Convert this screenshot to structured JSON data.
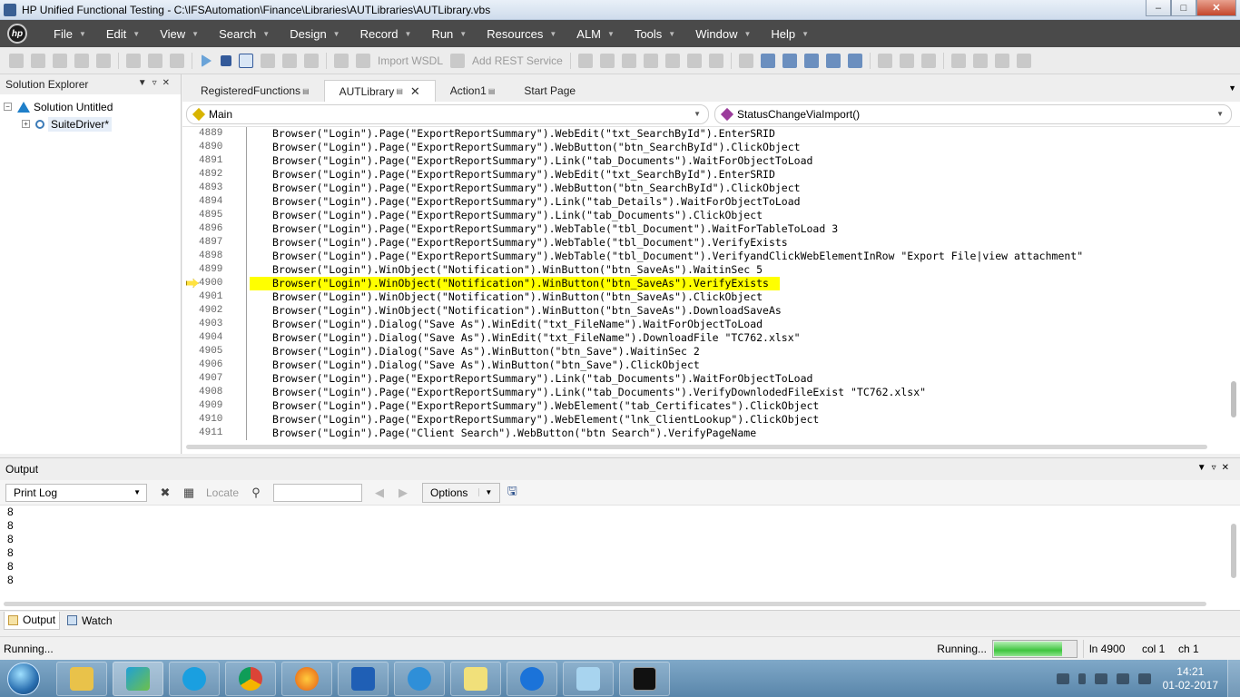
{
  "window": {
    "title": "HP Unified Functional Testing - C:\\IFSAutomation\\Finance\\Libraries\\AUTLibraries\\AUTLibrary.vbs",
    "minimize_icon": "minimize-icon",
    "maximize_icon": "maximize-icon",
    "close_icon": "close-icon"
  },
  "menubar": {
    "logo_text": "hp",
    "items": [
      {
        "label": "File"
      },
      {
        "label": "Edit"
      },
      {
        "label": "View"
      },
      {
        "label": "Search"
      },
      {
        "label": "Design"
      },
      {
        "label": "Record"
      },
      {
        "label": "Run"
      },
      {
        "label": "Resources"
      },
      {
        "label": "ALM"
      },
      {
        "label": "Tools"
      },
      {
        "label": "Window"
      },
      {
        "label": "Help"
      }
    ]
  },
  "toolbar": {
    "import_wsdl": "Import WSDL",
    "add_rest_service": "Add REST Service"
  },
  "solution_explorer": {
    "title": "Solution Explorer",
    "solution_label": "Solution Untitled",
    "suite_driver_label": "SuiteDriver*"
  },
  "editor": {
    "tabs": [
      {
        "label": "RegisteredFunctions"
      },
      {
        "label": "AUTLibrary"
      },
      {
        "label": "Action1"
      },
      {
        "label": "Start Page"
      }
    ],
    "scope_combo": "Main",
    "function_combo": "StatusChangeViaImport()",
    "current_line": 4900,
    "line_numbers": [
      "4889",
      "4890",
      "4891",
      "4892",
      "4893",
      "4894",
      "4895",
      "4896",
      "4897",
      "4898",
      "4899",
      "4900",
      "4901",
      "4902",
      "4903",
      "4904",
      "4905",
      "4906",
      "4907",
      "4908",
      "4909",
      "4910",
      "4911"
    ],
    "lines": [
      "Browser(\"Login\").Page(\"ExportReportSummary\").WebEdit(\"txt_SearchById\").EnterSRID",
      "Browser(\"Login\").Page(\"ExportReportSummary\").WebButton(\"btn_SearchById\").ClickObject",
      "Browser(\"Login\").Page(\"ExportReportSummary\").Link(\"tab_Documents\").WaitForObjectToLoad",
      "Browser(\"Login\").Page(\"ExportReportSummary\").WebEdit(\"txt_SearchById\").EnterSRID",
      "Browser(\"Login\").Page(\"ExportReportSummary\").WebButton(\"btn_SearchById\").ClickObject",
      "Browser(\"Login\").Page(\"ExportReportSummary\").Link(\"tab_Details\").WaitForObjectToLoad",
      "Browser(\"Login\").Page(\"ExportReportSummary\").Link(\"tab_Documents\").ClickObject",
      "Browser(\"Login\").Page(\"ExportReportSummary\").WebTable(\"tbl_Document\").WaitForTableToLoad 3",
      "Browser(\"Login\").Page(\"ExportReportSummary\").WebTable(\"tbl_Document\").VerifyExists",
      "Browser(\"Login\").Page(\"ExportReportSummary\").WebTable(\"tbl_Document\").VerifyandClickWebElementInRow \"Export File|view attachment\"",
      "Browser(\"Login\").WinObject(\"Notification\").WinButton(\"btn_SaveAs\").WaitinSec 5",
      "Browser(\"Login\").WinObject(\"Notification\").WinButton(\"btn_SaveAs\").VerifyExists",
      "Browser(\"Login\").WinObject(\"Notification\").WinButton(\"btn_SaveAs\").ClickObject",
      "Browser(\"Login\").WinObject(\"Notification\").WinButton(\"btn_SaveAs\").DownloadSaveAs",
      "Browser(\"Login\").Dialog(\"Save As\").WinEdit(\"txt_FileName\").WaitForObjectToLoad",
      "Browser(\"Login\").Dialog(\"Save As\").WinEdit(\"txt_FileName\").DownloadFile \"TC762.xlsx\"",
      "Browser(\"Login\").Dialog(\"Save As\").WinButton(\"btn_Save\").WaitinSec 2",
      "Browser(\"Login\").Dialog(\"Save As\").WinButton(\"btn_Save\").ClickObject",
      "Browser(\"Login\").Page(\"ExportReportSummary\").Link(\"tab_Documents\").WaitForObjectToLoad",
      "Browser(\"Login\").Page(\"ExportReportSummary\").Link(\"tab_Documents\").VerifyDownlodedFileExist \"TC762.xlsx\"",
      "Browser(\"Login\").Page(\"ExportReportSummary\").WebElement(\"tab_Certificates\").ClickObject",
      "Browser(\"Login\").Page(\"ExportReportSummary\").WebElement(\"lnk_ClientLookup\").ClickObject",
      "Browser(\"Login\").Page(\"Client Search\").WebButton(\"btn Search\").VerifyPageName"
    ]
  },
  "output": {
    "title": "Output",
    "print_log_select": "Print Log",
    "locate_label": "Locate",
    "search_value": "",
    "options_label": "Options",
    "lines": [
      "8",
      "8",
      "8",
      "8",
      "8",
      "8"
    ]
  },
  "bottom_tabs": [
    {
      "label": "Output"
    },
    {
      "label": "Watch"
    }
  ],
  "statusbar": {
    "left_text": "Running...",
    "right_text": "Running...",
    "progress_fraction": 0.82,
    "line": "ln 4900",
    "col": "col 1",
    "ch": "ch 1"
  },
  "taskbar": {
    "time": "14:21",
    "date": "01-02-2017",
    "apps": [
      "explorer-icon",
      "uft-icon",
      "skype-icon",
      "chrome-icon",
      "firefox-icon",
      "outlook-icon",
      "ie-icon",
      "folder-icon",
      "teamviewer-icon",
      "notepad-icon",
      "cmd-icon"
    ]
  },
  "colors": {
    "menubar_bg": "#4a4a4a",
    "highlight": "#ffff00",
    "string_literal": "#8b0000"
  }
}
